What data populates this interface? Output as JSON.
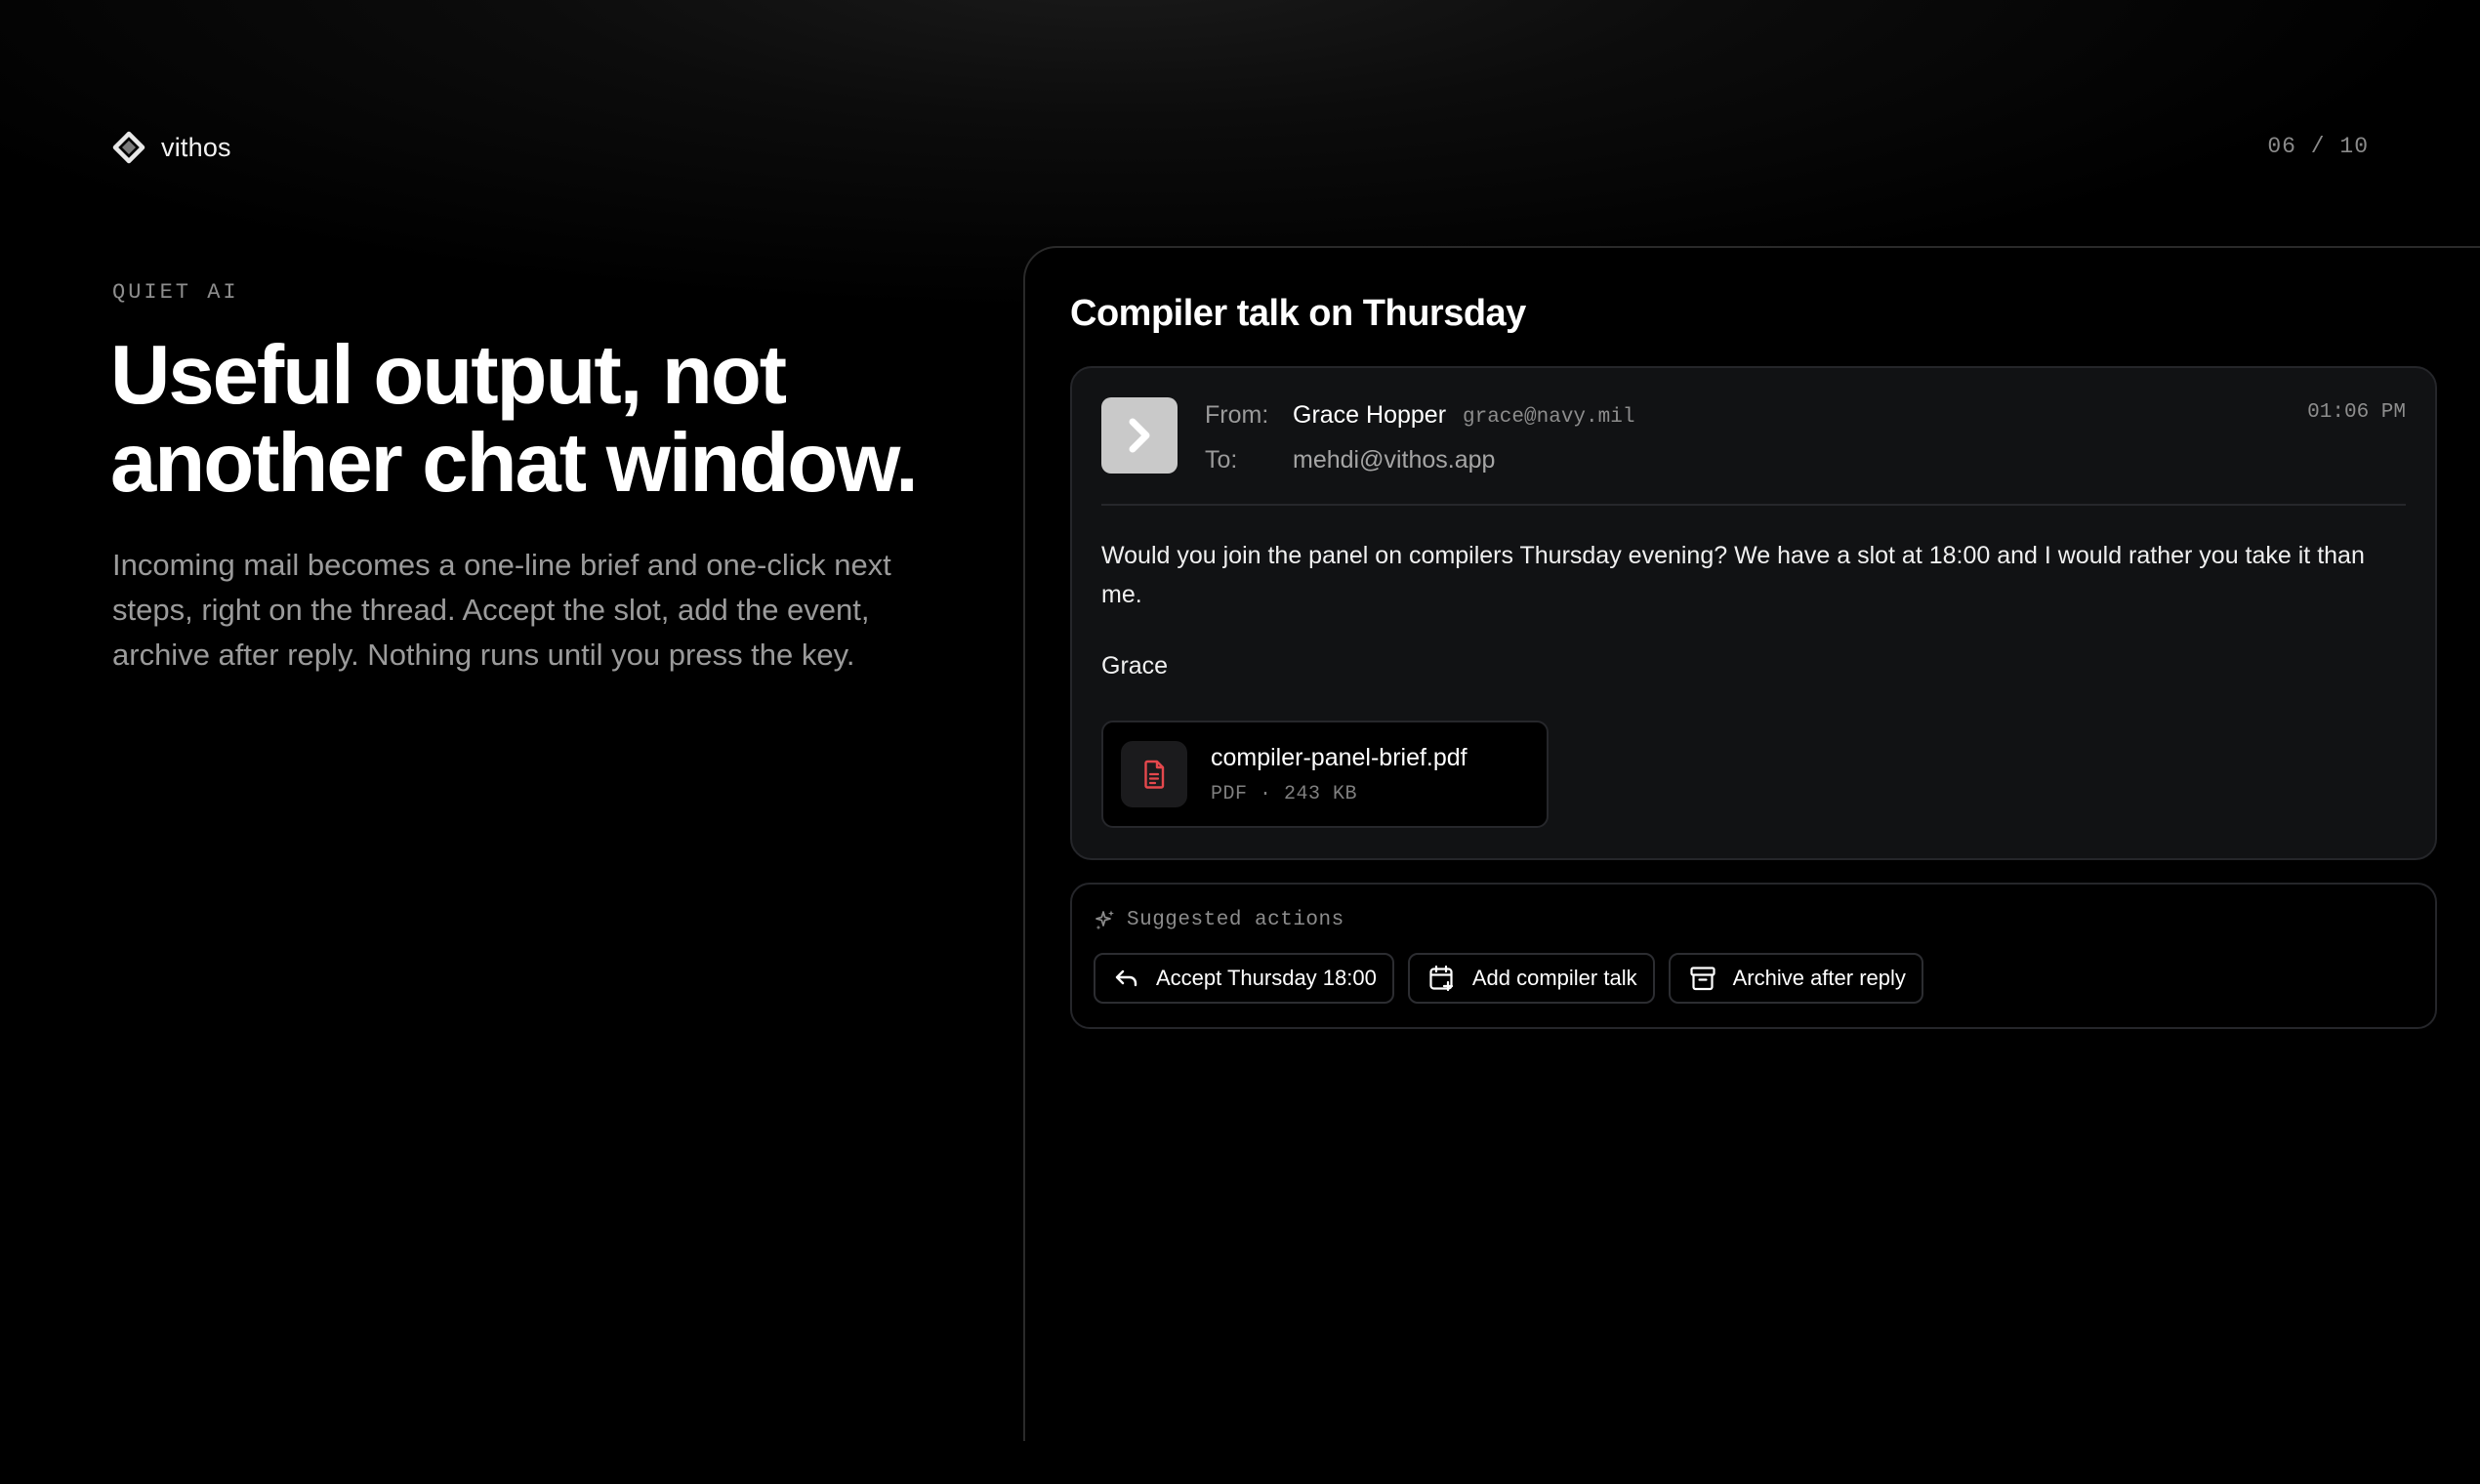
{
  "brand": {
    "name": "vithos",
    "logo_icon": "diamond-logo-icon"
  },
  "pager": {
    "text": "06 / 10"
  },
  "hero": {
    "eyebrow": "QUIET AI",
    "headline_line1": "Useful output, not",
    "headline_line2": "another chat window.",
    "lede": "Incoming mail becomes a one-line brief and one-click next steps, right on the thread. Accept the slot, add the event, archive after reply. Nothing runs until you press the key."
  },
  "thread": {
    "title": "Compiler talk on Thursday",
    "mail": {
      "from_label": "From:",
      "to_label": "To:",
      "sender_name": "Grace Hopper",
      "sender_email": "grace@navy.mil",
      "recipient": "mehdi@vithos.app",
      "time": "01:06 PM",
      "avatar_icon": "chevron-right-icon",
      "body": "Would you join the panel on compilers Thursday evening? We have a slot at 18:00 and I would rather you take it than me.",
      "signature": "Grace",
      "attachment": {
        "name": "compiler-panel-brief.pdf",
        "meta": "PDF · 243 KB",
        "icon": "file-icon",
        "icon_color": "#e5484d"
      }
    },
    "suggested": {
      "label": "Suggested actions",
      "icon": "sparkles-icon",
      "actions": [
        {
          "label": "Accept Thursday 18:00",
          "icon": "reply-icon"
        },
        {
          "label": "Add compiler talk",
          "icon": "calendar-plus-icon"
        },
        {
          "label": "Archive after reply",
          "icon": "archive-icon"
        }
      ]
    }
  }
}
